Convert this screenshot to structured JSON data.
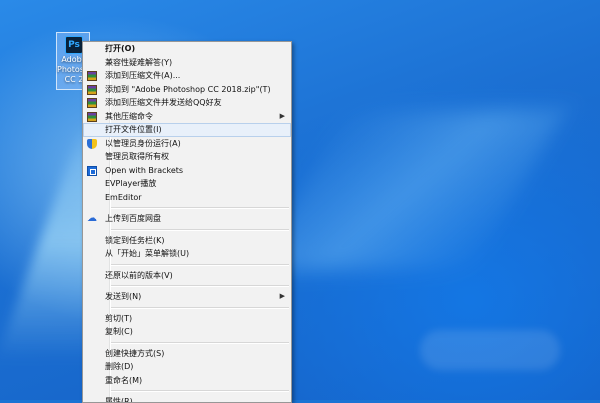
{
  "desktop_icon": {
    "app_glyph": "Ps",
    "label_lines": [
      "Adobe",
      "Photoshop",
      "CC 2"
    ]
  },
  "context_menu": {
    "items": [
      {
        "label": "打开(O)",
        "bold": true
      },
      {
        "label": "兼容性疑难解答(Y)"
      },
      {
        "label": "添加到压缩文件(A)...",
        "icon": "winrar-icon"
      },
      {
        "label": "添加到 \"Adobe Photoshop CC 2018.zip\"(T)",
        "icon": "winrar-icon"
      },
      {
        "label": "添加到压缩文件并发送给QQ好友",
        "icon": "winrar-icon"
      },
      {
        "label": "其他压缩命令",
        "icon": "winrar-icon",
        "submenu": true
      },
      {
        "label": "打开文件位置(I)",
        "highlight": true
      },
      {
        "label": "以管理员身份运行(A)",
        "icon": "uac-shield-icon"
      },
      {
        "label": "管理员取得所有权"
      },
      {
        "label": "Open with Brackets",
        "icon": "brackets-icon"
      },
      {
        "label": "EVPlayer播放"
      },
      {
        "label": "EmEditor"
      },
      {
        "separator": true
      },
      {
        "label": "上传到百度网盘",
        "icon": "baidu-cloud-icon"
      },
      {
        "separator": true
      },
      {
        "label": "锁定到任务栏(K)"
      },
      {
        "label": "从「开始」菜单解锁(U)"
      },
      {
        "separator": true
      },
      {
        "label": "还原以前的版本(V)"
      },
      {
        "separator": true
      },
      {
        "label": "发送到(N)",
        "submenu": true
      },
      {
        "separator": true
      },
      {
        "label": "剪切(T)"
      },
      {
        "label": "复制(C)"
      },
      {
        "separator": true
      },
      {
        "label": "创建快捷方式(S)"
      },
      {
        "label": "删除(D)"
      },
      {
        "label": "重命名(M)"
      },
      {
        "separator": true
      },
      {
        "label": "属性(R)"
      }
    ]
  },
  "submenu_arrow": "▶"
}
